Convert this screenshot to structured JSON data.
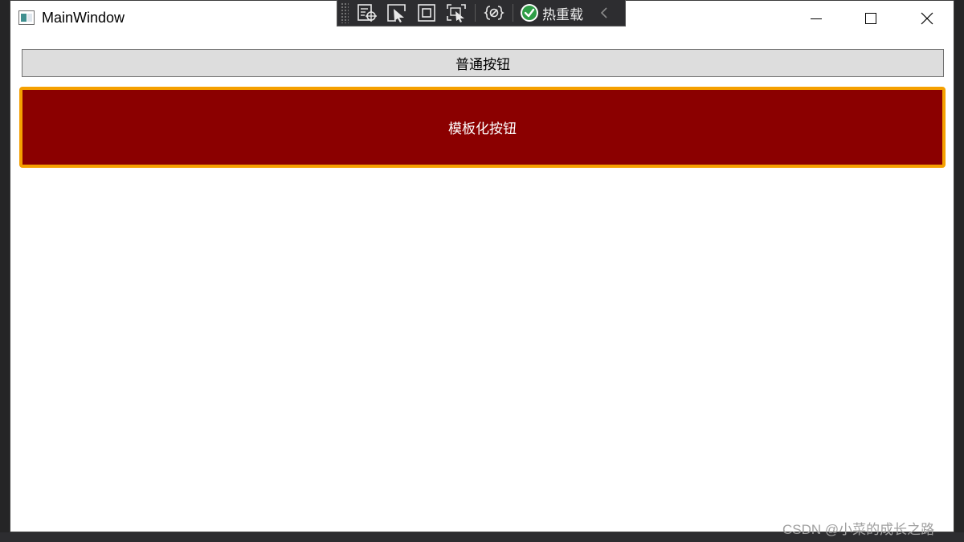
{
  "window": {
    "title": "MainWindow"
  },
  "debug_toolbar": {
    "icons": [
      "live-visual-tree-icon",
      "select-element-icon",
      "display-layout-adorners-icon",
      "track-focus-icon",
      "binding-failures-icon"
    ],
    "hot_reload_label": "热重载"
  },
  "content": {
    "normal_button_label": "普通按钮",
    "template_button_label": "模板化按钮"
  },
  "watermark": "CSDN @小菜的成长之路",
  "colors": {
    "template_button_bg": "#8b0000",
    "template_button_border": "#f5a000",
    "hot_reload_ok": "#2e9d46",
    "normal_button_bg": "#dddddd"
  }
}
